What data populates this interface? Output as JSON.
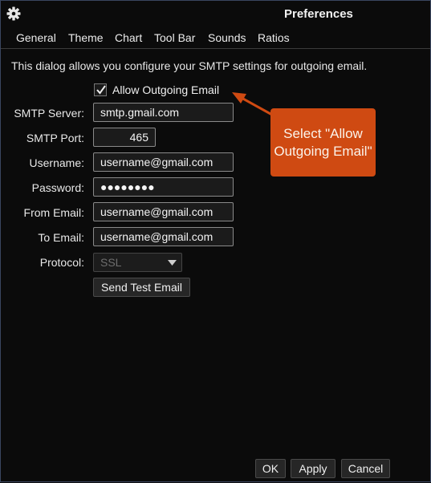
{
  "window": {
    "title": "Preferences",
    "gear_icon": "gear-icon"
  },
  "tabs": [
    {
      "label": "General"
    },
    {
      "label": "Theme"
    },
    {
      "label": "Chart"
    },
    {
      "label": "Tool Bar"
    },
    {
      "label": "Sounds"
    },
    {
      "label": "Ratios"
    }
  ],
  "description": "This dialog allows you configure your SMTP settings for outgoing email.",
  "allow_outgoing": {
    "label": "Allow Outgoing Email",
    "checked": true
  },
  "form": {
    "smtp_server": {
      "label": "SMTP Server:",
      "value": "smtp.gmail.com"
    },
    "smtp_port": {
      "label": "SMTP Port:",
      "value": "465"
    },
    "username": {
      "label": "Username:",
      "value": "username@gmail.com"
    },
    "password": {
      "label": "Password:",
      "value": "●●●●●●●●"
    },
    "from_email": {
      "label": "From Email:",
      "value": "username@gmail.com"
    },
    "to_email": {
      "label": "To Email:",
      "value": "username@gmail.com"
    },
    "protocol": {
      "label": "Protocol:",
      "value": "SSL",
      "disabled": true
    }
  },
  "send_test_label": "Send Test Email",
  "footer": {
    "ok_label": "OK",
    "apply_label": "Apply",
    "cancel_label": "Cancel"
  },
  "callout": {
    "text": "Select \"Allow Outgoing Email\"",
    "color": "#cf4a12"
  }
}
